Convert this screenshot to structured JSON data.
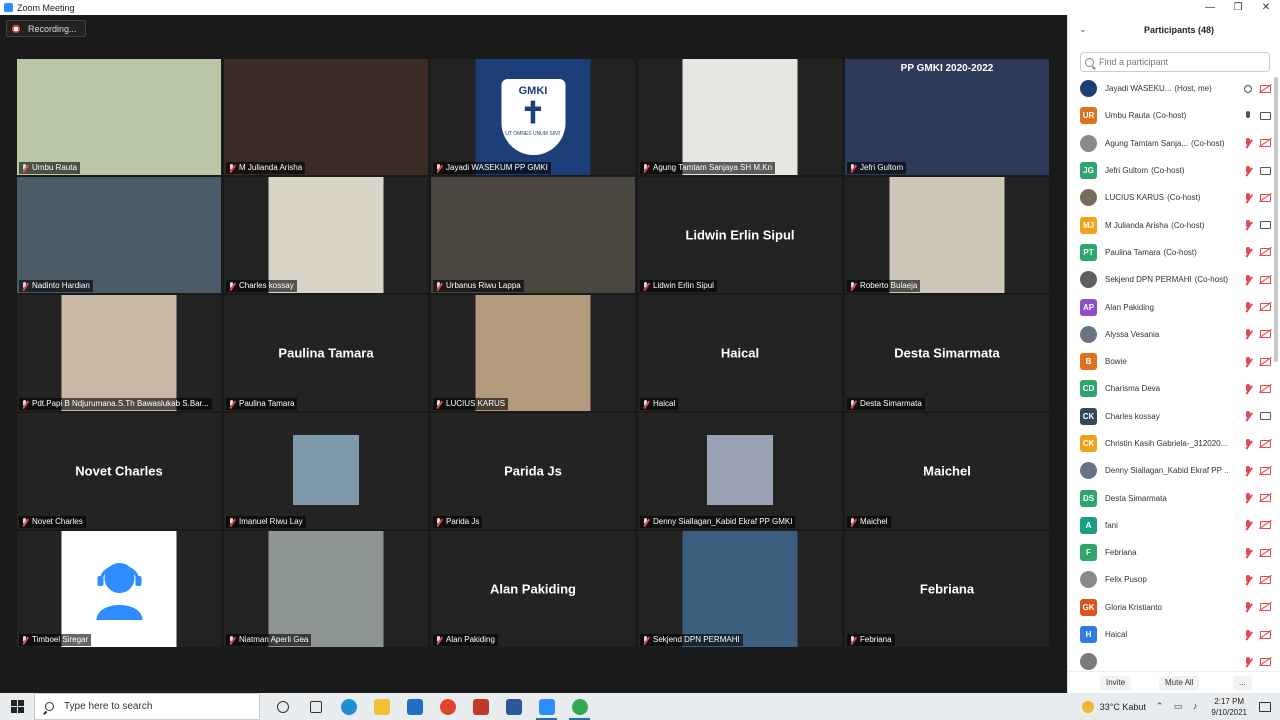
{
  "window": {
    "title": "Zoom Meeting",
    "controls": [
      "—",
      "❐",
      "✕"
    ]
  },
  "meeting": {
    "recording_label": "Recording...",
    "tiles": [
      {
        "name": "Umbu Rauta",
        "has_video": true,
        "active": true,
        "mic_muted": false,
        "video_color": "#b9c6a8"
      },
      {
        "name": "M Julianda Arisha",
        "has_video": true,
        "mic_muted": true,
        "video_color": "#3a2b24"
      },
      {
        "name": "Jayadi WASEKUM PP GMKI",
        "has_video": true,
        "mic_muted": true,
        "video_color": "#1c3f7a",
        "logo_text": "GMKI",
        "logo_motto": "UT OMNES UNUM SINT",
        "framed": true
      },
      {
        "name": "Agung Tamtam Sanjaya SH M.Kn",
        "has_video": true,
        "mic_muted": true,
        "video_color": "#e8e6e0",
        "framed": true
      },
      {
        "name": "Jefri Gultom",
        "has_video": true,
        "mic_muted": true,
        "video_color": "#2d3a5a",
        "banner": "PP GMKI 2020-2022"
      },
      {
        "name": "Nadinto Hardian",
        "has_video": true,
        "mic_muted": true,
        "video_color": "#4a5a66"
      },
      {
        "name": "Charles kossay",
        "has_video": true,
        "mic_muted": true,
        "video_color": "#d9d3c8",
        "framed": true
      },
      {
        "name": "Urbanus Riwu Lappa",
        "has_video": true,
        "mic_muted": true,
        "video_color": "#4a4640"
      },
      {
        "name": "Lidwin Erlin Sipul",
        "has_video": false,
        "mic_muted": true
      },
      {
        "name": "Roberto Bulaeja",
        "has_video": true,
        "mic_muted": true,
        "video_color": "#cfc7b8",
        "framed": true
      },
      {
        "name": "Pdt.Papi B Ndjurumana.S.Th Bawaslukab S.Bar...",
        "has_video": true,
        "mic_muted": true,
        "video_color": "#c9b9a6",
        "framed": true
      },
      {
        "name": "Paulina Tamara",
        "has_video": false,
        "mic_muted": true
      },
      {
        "name": "LUCIUS KARUS",
        "has_video": true,
        "mic_muted": true,
        "video_color": "#b49a7c",
        "framed": true
      },
      {
        "name": "Haical",
        "has_video": false,
        "mic_muted": true
      },
      {
        "name": "Desta Simarmata",
        "has_video": false,
        "mic_muted": true
      },
      {
        "name": "Novet Charles",
        "has_video": false,
        "mic_muted": true
      },
      {
        "name": "Imanuel Riwu Lay",
        "has_video": true,
        "mic_muted": true,
        "video_color": "#7f9aa8",
        "small": true
      },
      {
        "name": "Parida Js",
        "has_video": false,
        "mic_muted": true
      },
      {
        "name": "Denny Siallagan_Kabid Ekraf PP GMKI",
        "has_video": true,
        "mic_muted": true,
        "video_color": "#9aa3b5",
        "small": true
      },
      {
        "name": "Maichel",
        "has_video": false,
        "mic_muted": true
      },
      {
        "name": "Timboel Siregar",
        "has_video": true,
        "mic_muted": true,
        "video_color": "#ffffff",
        "framed": true,
        "avatar_icon": true
      },
      {
        "name": "Niatman Aperli Gea",
        "has_video": true,
        "mic_muted": true,
        "video_color": "#8d9591",
        "framed": true
      },
      {
        "name": "Alan Pakiding",
        "has_video": false,
        "mic_muted": true
      },
      {
        "name": "Sekjend DPN PERMAHI",
        "has_video": true,
        "mic_muted": true,
        "video_color": "#3d5f7f",
        "framed": true
      },
      {
        "name": "Febriana",
        "has_video": false,
        "mic_muted": true
      }
    ]
  },
  "sidebar": {
    "title": "Participants (48)",
    "search_placeholder": "Find a participant",
    "participants": [
      {
        "initials": "",
        "name": "Jayadi WASEKU...",
        "role": "(Host, me)",
        "color": "#1c3f7a",
        "mic": "share",
        "cam": "off",
        "photo": true
      },
      {
        "initials": "UR",
        "name": "Umbu Rauta",
        "role": "(Co-host)",
        "color": "#e0711d",
        "mic": "on",
        "cam": "on"
      },
      {
        "initials": "",
        "name": "Agung Tamtam Sanja...",
        "role": "(Co-host)",
        "color": "#8a8a8a",
        "mic": "off",
        "cam": "off",
        "photo": true
      },
      {
        "initials": "JG",
        "name": "Jefri Gultom",
        "role": "(Co-host)",
        "color": "#2ea66b",
        "mic": "off",
        "cam": "on"
      },
      {
        "initials": "",
        "name": "LUCIUS KARUS",
        "role": "(Co-host)",
        "color": "#7a6b5a",
        "mic": "off",
        "cam": "off",
        "photo": true
      },
      {
        "initials": "MJ",
        "name": "M Julianda Arisha",
        "role": "(Co-host)",
        "color": "#f0a31a",
        "mic": "off",
        "cam": "on"
      },
      {
        "initials": "PT",
        "name": "Paulina Tamara",
        "role": "(Co-host)",
        "color": "#2ea66b",
        "mic": "off",
        "cam": "off"
      },
      {
        "initials": "",
        "name": "Sekjend DPN PERMAHI",
        "role": "(Co-host)",
        "color": "#5f5f5f",
        "mic": "off",
        "cam": "off",
        "photo": true
      },
      {
        "initials": "AP",
        "name": "Alan Pakiding",
        "role": "",
        "color": "#8e4fc6",
        "mic": "off",
        "cam": "off"
      },
      {
        "initials": "",
        "name": "Alyssa Vesania",
        "role": "",
        "color": "#6a7480",
        "mic": "off",
        "cam": "off",
        "photo": true
      },
      {
        "initials": "B",
        "name": "Bowie",
        "role": "",
        "color": "#e0711d",
        "mic": "off",
        "cam": "off"
      },
      {
        "initials": "CD",
        "name": "Charisma Deva",
        "role": "",
        "color": "#2ea66b",
        "mic": "off",
        "cam": "off"
      },
      {
        "initials": "CK",
        "name": "Charles kossay",
        "role": "",
        "color": "#36465c",
        "mic": "off",
        "cam": "on"
      },
      {
        "initials": "CK",
        "name": "Christin Kasih Gabriela-_312020...",
        "role": "",
        "color": "#f0a31a",
        "mic": "off",
        "cam": "off"
      },
      {
        "initials": "",
        "name": "Denny Siallagan_Kabid Ekraf PP ...",
        "role": "",
        "color": "#6a6f8a",
        "mic": "off",
        "cam": "off",
        "photo": true
      },
      {
        "initials": "DS",
        "name": "Desta Simarmata",
        "role": "",
        "color": "#2ea66b",
        "mic": "off",
        "cam": "off"
      },
      {
        "initials": "A",
        "name": "fani",
        "role": "",
        "color": "#1a9f82",
        "mic": "off",
        "cam": "off"
      },
      {
        "initials": "F",
        "name": "Febriana",
        "role": "",
        "color": "#2ea66b",
        "mic": "off",
        "cam": "off"
      },
      {
        "initials": "",
        "name": "Felix Pusop",
        "role": "",
        "color": "#8a8a8a",
        "mic": "off",
        "cam": "off",
        "photo": true
      },
      {
        "initials": "GK",
        "name": "Gloria Kristianto",
        "role": "",
        "color": "#d9541e",
        "mic": "off",
        "cam": "off"
      },
      {
        "initials": "H",
        "name": "Haical",
        "role": "",
        "color": "#2d7de0",
        "mic": "off",
        "cam": "off"
      },
      {
        "initials": "",
        "name": "",
        "role": "",
        "color": "#7a7a7a",
        "mic": "off",
        "cam": "off",
        "photo": true
      }
    ],
    "invite_label": "Invite",
    "mute_all_label": "Mute All",
    "more_label": "..."
  },
  "taskbar": {
    "search_placeholder": "Type here to search",
    "apps": [
      {
        "icon": "task-view-icon",
        "color": "#333333"
      },
      {
        "icon": "widgets-icon",
        "color": "#333333"
      },
      {
        "icon": "edge-icon",
        "color": "#1d8fd1"
      },
      {
        "icon": "file-explorer-icon",
        "color": "#f2c037"
      },
      {
        "icon": "mail-icon",
        "color": "#1f6fc2"
      },
      {
        "icon": "chrome-icon",
        "color": "#e0452f"
      },
      {
        "icon": "store-icon",
        "color": "#c0392b"
      },
      {
        "icon": "word-icon",
        "color": "#2b579a"
      },
      {
        "icon": "zoom-icon",
        "color": "#2d8cff"
      },
      {
        "icon": "chrome-icon-2",
        "color": "#34a853"
      }
    ],
    "weather": "33°C  Kabut",
    "time": "2:17 PM",
    "date": "9/10/2021"
  }
}
